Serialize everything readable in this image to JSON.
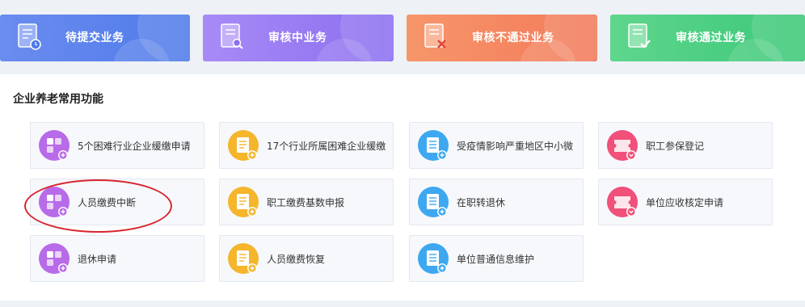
{
  "status_cards": [
    {
      "label": "待提交业务",
      "colors": [
        "#6b8cf0",
        "#4f7be9"
      ],
      "icon": "clock-doc-icon"
    },
    {
      "label": "审核中业务",
      "colors": [
        "#a88af6",
        "#8b6ff0"
      ],
      "icon": "search-doc-icon"
    },
    {
      "label": "审核不通过业务",
      "colors": [
        "#f7966a",
        "#f27a5a"
      ],
      "icon": "reject-doc-icon"
    },
    {
      "label": "审核通过业务",
      "colors": [
        "#5fd68d",
        "#3cc878"
      ],
      "icon": "approved-doc-icon"
    }
  ],
  "section": {
    "title": "企业养老常用功能"
  },
  "functions": [
    {
      "label": "5个困难行业企业缓缴申请",
      "color": "#b86be8",
      "icon": "grid-plus-icon"
    },
    {
      "label": "17个行业所属困难企业缓缴",
      "color": "#f5b62c",
      "icon": "form-plus-icon"
    },
    {
      "label": "受疫情影响严重地区中小微",
      "color": "#3da8f0",
      "icon": "list-plus-icon"
    },
    {
      "label": "职工参保登记",
      "color": "#f0507a",
      "icon": "ticket-icon"
    },
    {
      "label": "人员缴费中断",
      "color": "#b86be8",
      "icon": "grid-plus-icon"
    },
    {
      "label": "职工缴费基数申报",
      "color": "#f5b62c",
      "icon": "form-plus-icon"
    },
    {
      "label": "在职转退休",
      "color": "#3da8f0",
      "icon": "list-plus-icon"
    },
    {
      "label": "单位应收核定申请",
      "color": "#f0507a",
      "icon": "ticket-icon"
    },
    {
      "label": "退休申请",
      "color": "#b86be8",
      "icon": "grid-plus-icon"
    },
    {
      "label": "人员缴费恢复",
      "color": "#f5b62c",
      "icon": "form-plus-icon"
    },
    {
      "label": "单位普通信息维护",
      "color": "#3da8f0",
      "icon": "list-plus-icon"
    }
  ],
  "annotation": {
    "color": "#d8252f",
    "target": "人员缴费中断"
  }
}
